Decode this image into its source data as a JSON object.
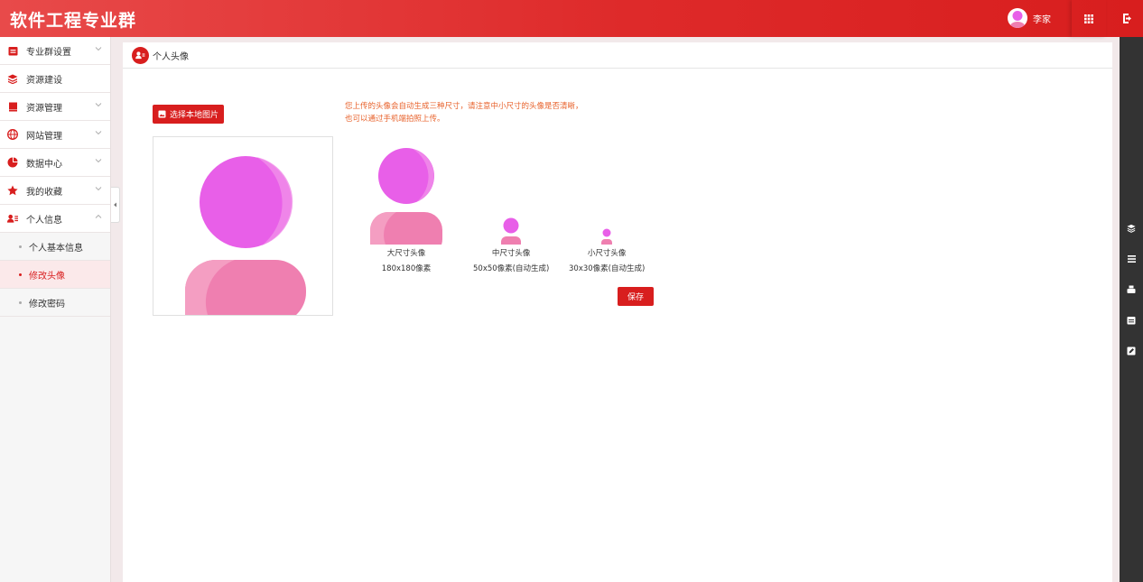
{
  "app": {
    "title": "软件工程专业群"
  },
  "header": {
    "user_name": "李家",
    "apps_icon": "grid-icon",
    "logout_icon": "logout-icon"
  },
  "sidebar": {
    "items": [
      {
        "label": "专业群设置",
        "icon": "calendar-icon",
        "chevron": "down"
      },
      {
        "label": "资源建设",
        "icon": "layers-icon",
        "chevron": ""
      },
      {
        "label": "资源管理",
        "icon": "book-icon",
        "chevron": "down"
      },
      {
        "label": "网站管理",
        "icon": "globe-icon",
        "chevron": "down"
      },
      {
        "label": "数据中心",
        "icon": "pie-chart-icon",
        "chevron": "down"
      },
      {
        "label": "我的收藏",
        "icon": "star-icon",
        "chevron": "down"
      },
      {
        "label": "个人信息",
        "icon": "user-card-icon",
        "chevron": "up"
      }
    ],
    "sub_items": [
      {
        "label": "个人基本信息",
        "active": false
      },
      {
        "label": "修改头像",
        "active": true
      },
      {
        "label": "修改密码",
        "active": false
      }
    ]
  },
  "page": {
    "title": "个人头像",
    "pick_button": "选择本地图片",
    "notice_line1": "您上传的头像会自动生成三种尺寸，请注意中小尺寸的头像是否清晰，",
    "notice_line2": "也可以通过手机端拍照上传。",
    "previews": [
      {
        "label": "大尺寸头像",
        "size": "180x180像素"
      },
      {
        "label": "中尺寸头像",
        "size": "50x50像素(自动生成)"
      },
      {
        "label": "小尺寸头像",
        "size": "30x30像素(自动生成)"
      }
    ],
    "save_button": "保存"
  },
  "colors": {
    "brand_red": "#d81e1e",
    "notice_orange": "#e8632d",
    "avatar_head": "#e85fe8",
    "avatar_body": "#ef7fb0"
  },
  "rightbar_icons": [
    "layers-icon",
    "list-icon",
    "print-icon",
    "calendar-icon",
    "edit-icon"
  ]
}
